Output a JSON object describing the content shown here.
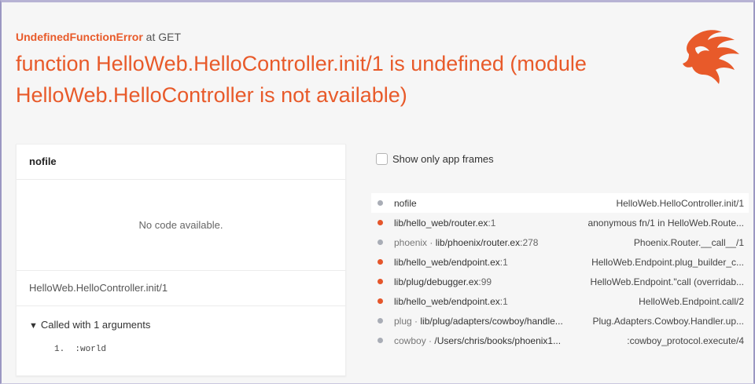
{
  "error": {
    "type": "UndefinedFunctionError",
    "context": "at GET",
    "message": "function HelloWeb.HelloController.init/1 is undefined (module HelloWeb.HelloController is not available)"
  },
  "code_panel": {
    "file": "nofile",
    "empty_text": "No code available.",
    "function": "HelloWeb.HelloController.init/1",
    "args_toggle": "Called with 1 arguments",
    "args": [
      "1.  :world"
    ]
  },
  "filter": {
    "label": "Show only app frames",
    "checked": false
  },
  "frames": [
    {
      "kind": "lib",
      "app": "",
      "file": "nofile",
      "line": "",
      "info": "HelloWeb.HelloController.init/1",
      "active": true
    },
    {
      "kind": "app",
      "app": "",
      "file": "lib/hello_web/router.ex",
      "line": ":1",
      "info": "anonymous fn/1 in HelloWeb.Route...",
      "active": false
    },
    {
      "kind": "lib",
      "app": "phoenix · ",
      "file": "lib/phoenix/router.ex",
      "line": ":278",
      "info": "Phoenix.Router.__call__/1",
      "active": false
    },
    {
      "kind": "app",
      "app": "",
      "file": "lib/hello_web/endpoint.ex",
      "line": ":1",
      "info": "HelloWeb.Endpoint.plug_builder_c...",
      "active": false
    },
    {
      "kind": "app",
      "app": "",
      "file": "lib/plug/debugger.ex",
      "line": ":99",
      "info": "HelloWeb.Endpoint.\"call (overridab...",
      "active": false
    },
    {
      "kind": "app",
      "app": "",
      "file": "lib/hello_web/endpoint.ex",
      "line": ":1",
      "info": "HelloWeb.Endpoint.call/2",
      "active": false
    },
    {
      "kind": "lib",
      "app": "plug · ",
      "file": "lib/plug/adapters/cowboy/handle...",
      "line": "",
      "info": "Plug.Adapters.Cowboy.Handler.up...",
      "active": false
    },
    {
      "kind": "lib",
      "app": "cowboy · ",
      "file": "/Users/chris/books/phoenix1...",
      "line": "",
      "info": ":cowboy_protocol.execute/4",
      "active": false
    }
  ],
  "colors": {
    "accent": "#e85a2a",
    "app_dot": "#e5562b",
    "lib_dot": "#a9adb6"
  },
  "icons": {
    "logo": "phoenix-logo-icon"
  }
}
